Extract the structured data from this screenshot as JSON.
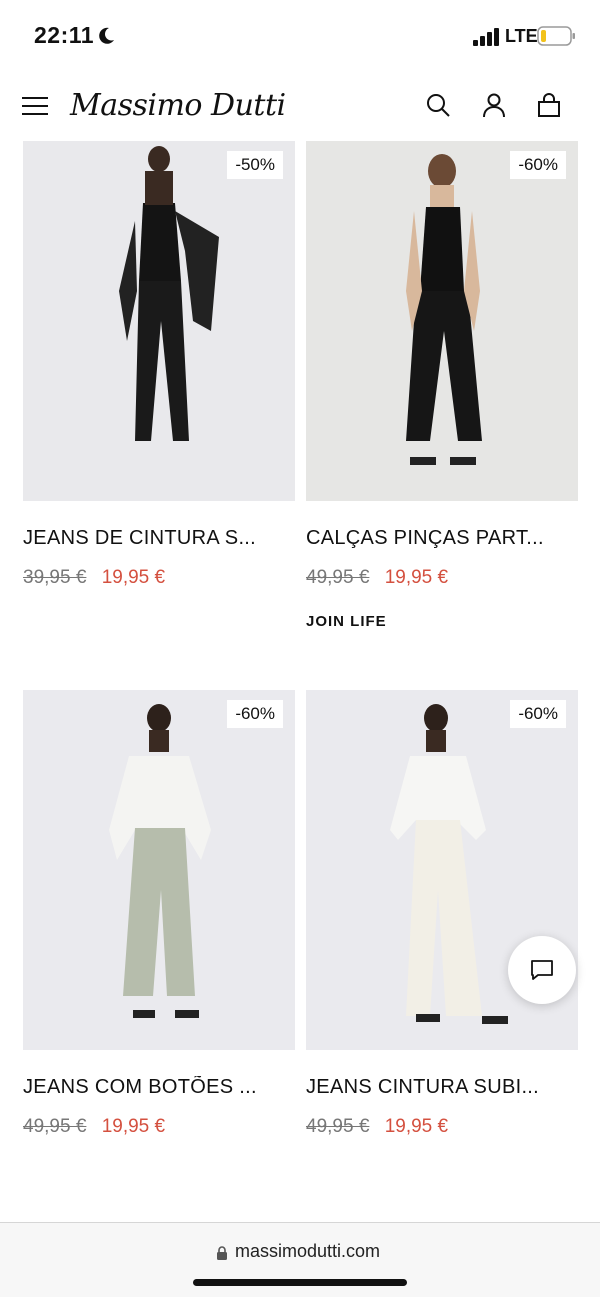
{
  "status_bar": {
    "time": "22:11",
    "network": "LTE"
  },
  "header": {
    "logo": "Massimo Dutti"
  },
  "products": [
    {
      "discount": "-50%",
      "name": "JEANS DE CINTURA S...",
      "old_price": "39,95 €",
      "new_price": "19,95 €",
      "tag": ""
    },
    {
      "discount": "-60%",
      "name": "CALÇAS PINÇAS PART...",
      "old_price": "49,95 €",
      "new_price": "19,95 €",
      "tag": "JOIN LIFE"
    },
    {
      "discount": "-60%",
      "name": "JEANS COM BOTÕES ...",
      "old_price": "49,95 €",
      "new_price": "19,95 €",
      "tag": ""
    },
    {
      "discount": "-60%",
      "name": "JEANS CINTURA SUBI...",
      "old_price": "49,95 €",
      "new_price": "19,95 €",
      "tag": ""
    }
  ],
  "url_bar": {
    "url": "massimodutti.com"
  },
  "colors": {
    "sale_price": "#d4503f",
    "old_price": "#777777"
  }
}
